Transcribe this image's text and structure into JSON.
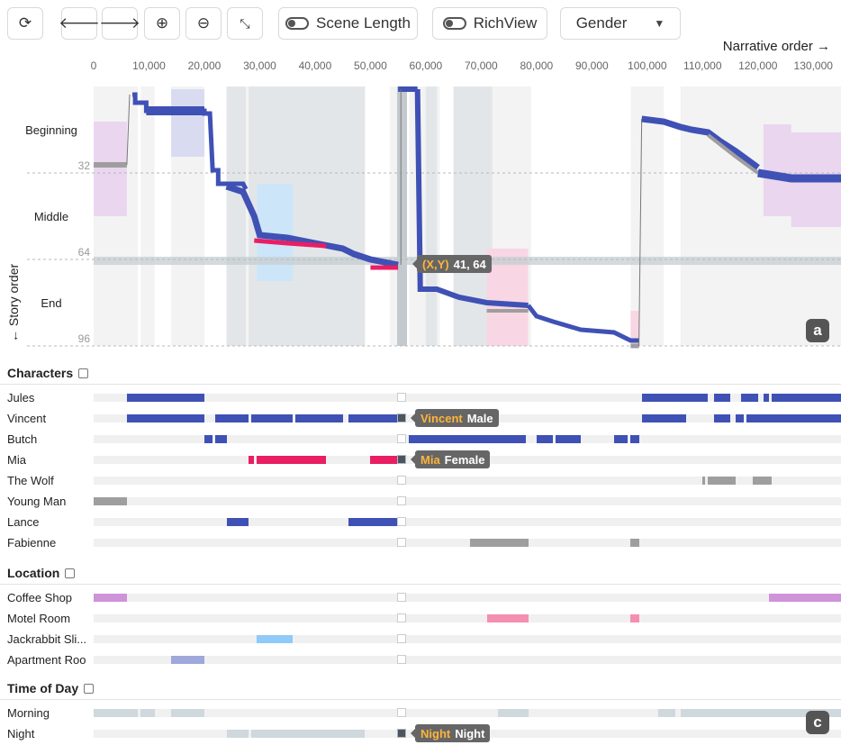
{
  "toolbar": {
    "scene_length_label": "Scene Length",
    "richview_label": "RichView",
    "group_by_value": "Gender",
    "icons": [
      "refresh-icon",
      "arrow-left-icon",
      "arrow-right-icon",
      "zoom-in-icon",
      "zoom-out-icon",
      "collapse-icon"
    ]
  },
  "axes": {
    "x_title": "Narrative order →",
    "y_title": "← Story order",
    "x_ticks": [
      "0",
      "10,000",
      "20,000",
      "30,000",
      "40,000",
      "50,000",
      "60,000",
      "70,000",
      "80,000",
      "90,000",
      "100,000",
      "110,000",
      "120,000",
      "130,000"
    ],
    "y_ticks": [
      "32",
      "64",
      "96"
    ],
    "x_max": 135000,
    "y_max": 96
  },
  "regions": [
    "Beginning",
    "Middle",
    "End"
  ],
  "plot_badge": "a",
  "crosshair": {
    "key": "(X,Y)",
    "value": "41, 64"
  },
  "colors": {
    "male": "#3f51b5",
    "female": "#e91e63",
    "unknown": "#9e9e9e"
  },
  "characters": {
    "title": "Characters",
    "rows": [
      {
        "name": "Jules",
        "color": "#3f51b5",
        "segments": [
          [
            6000,
            20000
          ],
          [
            99000,
            111000
          ],
          [
            112000,
            115000
          ],
          [
            117000,
            120000
          ],
          [
            121000,
            122000
          ],
          [
            122500,
            135000
          ]
        ]
      },
      {
        "name": "Vincent",
        "color": "#3f51b5",
        "segments": [
          [
            6000,
            20000
          ],
          [
            22000,
            28000
          ],
          [
            28500,
            36000
          ],
          [
            36500,
            45000
          ],
          [
            46000,
            55000
          ],
          [
            99000,
            107000
          ],
          [
            112000,
            115000
          ],
          [
            116000,
            117500
          ],
          [
            118000,
            135000
          ]
        ]
      },
      {
        "name": "Butch",
        "color": "#3f51b5",
        "segments": [
          [
            20000,
            21500
          ],
          [
            22000,
            24000
          ],
          [
            57000,
            78000
          ],
          [
            80000,
            83000
          ],
          [
            83500,
            88000
          ],
          [
            94000,
            96500
          ],
          [
            97000,
            98500
          ]
        ]
      },
      {
        "name": "Mia",
        "color": "#e91e63",
        "segments": [
          [
            28000,
            29000
          ],
          [
            29500,
            42000
          ],
          [
            50000,
            55000
          ]
        ]
      },
      {
        "name": "The Wolf",
        "color": "#9e9e9e",
        "segments": [
          [
            110000,
            110500
          ],
          [
            111000,
            116000
          ],
          [
            119000,
            122500
          ]
        ]
      },
      {
        "name": "Young Man",
        "color": "#9e9e9e",
        "segments": [
          [
            0,
            6000
          ]
        ]
      },
      {
        "name": "Lance",
        "color": "#3f51b5",
        "segments": [
          [
            24000,
            28000
          ],
          [
            46000,
            55000
          ]
        ]
      },
      {
        "name": "Fabienne",
        "color": "#9e9e9e",
        "segments": [
          [
            68000,
            78500
          ],
          [
            97000,
            98500
          ]
        ]
      }
    ],
    "tooltips": [
      {
        "row": 1,
        "key": "Vincent",
        "value": "Male"
      },
      {
        "row": 3,
        "key": "Mia",
        "value": "Female"
      }
    ]
  },
  "location": {
    "title": "Location",
    "rows": [
      {
        "name": "Coffee Shop",
        "color": "#ce93d8",
        "segments": [
          [
            0,
            6000
          ],
          [
            122000,
            135000
          ]
        ]
      },
      {
        "name": "Motel Room",
        "color": "#f48fb1",
        "segments": [
          [
            71000,
            78500
          ],
          [
            97000,
            98500
          ]
        ]
      },
      {
        "name": "Jackrabbit Sli...",
        "color": "#90caf9",
        "segments": [
          [
            29500,
            36000
          ]
        ]
      },
      {
        "name": "Apartment Roo",
        "color": "#9fa8da",
        "segments": [
          [
            14000,
            20000
          ]
        ]
      }
    ]
  },
  "time_of_day": {
    "title": "Time of Day",
    "rows": [
      {
        "name": "Morning",
        "color": "#cfd8dc",
        "segments": [
          [
            0,
            8000
          ],
          [
            8500,
            11000
          ],
          [
            14000,
            20000
          ],
          [
            73000,
            78500
          ],
          [
            102000,
            105000
          ],
          [
            106000,
            135000
          ]
        ]
      },
      {
        "name": "Night",
        "color": "#cfd8dc",
        "segments": [
          [
            24000,
            28000
          ],
          [
            28500,
            49000
          ],
          [
            55000,
            56000
          ]
        ]
      }
    ],
    "tooltips": [
      {
        "row": 1,
        "key": "Night",
        "value": "Night"
      }
    ]
  },
  "panel_badge": "c"
}
